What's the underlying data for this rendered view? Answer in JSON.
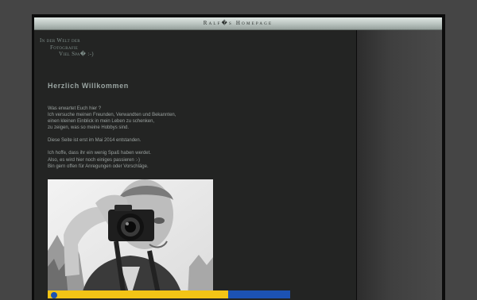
{
  "header": {
    "title": "Ralf�s Homepage"
  },
  "tagline": [
    "In der Welt der",
    "Fotografie",
    "Viel Spa� :-)"
  ],
  "main": {
    "heading": "Herzlich Willkommen",
    "paragraphs": [
      [
        "Was erwartet Euch hier ?",
        "Ich versuche meinen Freunden, Verwandten und Bekannten,",
        "einen kleinen Einblick in mein Leben zu schenken,",
        "zu zeigen, was so meine Hobbys sind."
      ],
      [
        "Diese Seite ist erst im Mai 2014 entstanden."
      ],
      [
        "Ich hoffe, dass ihr ein wenig Spaß haben werdet.",
        "Also, es wird hier noch einiges passieren :-)",
        "Bin gern offen für Anregungen oder Vorschläge."
      ]
    ]
  },
  "icons": {
    "photo": "photographer-portrait",
    "ad": "info-icon"
  },
  "colors": {
    "accent": "#9aa5a2",
    "ad_bg": "#f2c416",
    "ad_button": "#1c52b3"
  }
}
